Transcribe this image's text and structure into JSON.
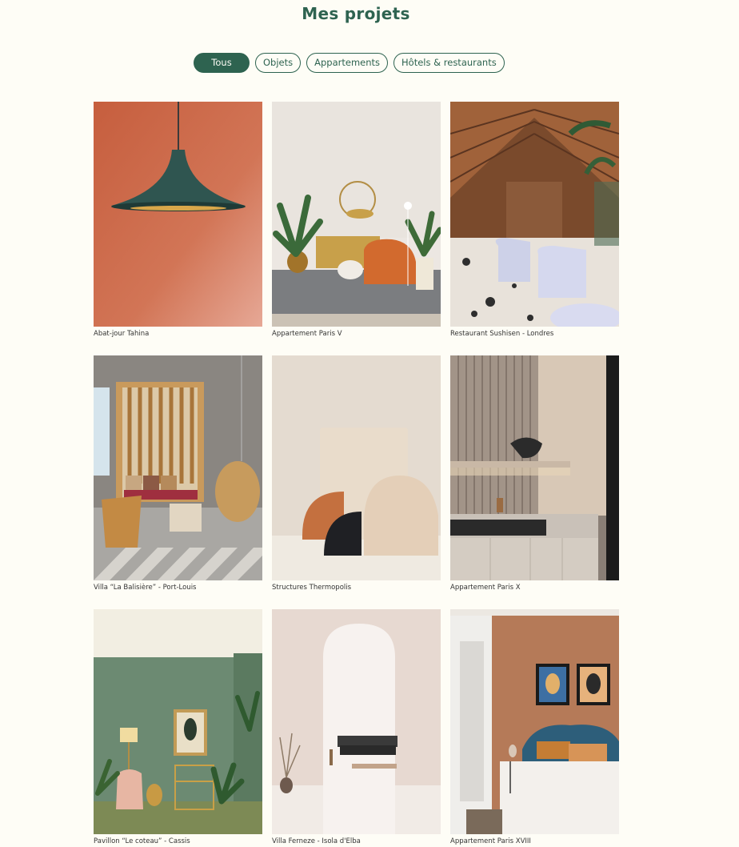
{
  "page": {
    "title": "Mes projets"
  },
  "filters": [
    {
      "label": "Tous",
      "active": true
    },
    {
      "label": "Objets",
      "active": false
    },
    {
      "label": "Appartements",
      "active": false
    },
    {
      "label": "Hôtels & restaurants",
      "active": false
    }
  ],
  "projects": [
    {
      "title": "Abat-jour Tahina"
    },
    {
      "title": "Appartement Paris V"
    },
    {
      "title": "Restaurant Sushisen - Londres"
    },
    {
      "title": "Villa “La Balisière” - Port-Louis"
    },
    {
      "title": "Structures Thermopolis"
    },
    {
      "title": "Appartement Paris X"
    },
    {
      "title": "Pavillon “Le coteau” - Cassis"
    },
    {
      "title": "Villa Ferneze - Isola d'Elba"
    },
    {
      "title": "Appartement Paris XVIII"
    }
  ],
  "colors": {
    "accent": "#2e6350",
    "background": "#fefdf6"
  }
}
